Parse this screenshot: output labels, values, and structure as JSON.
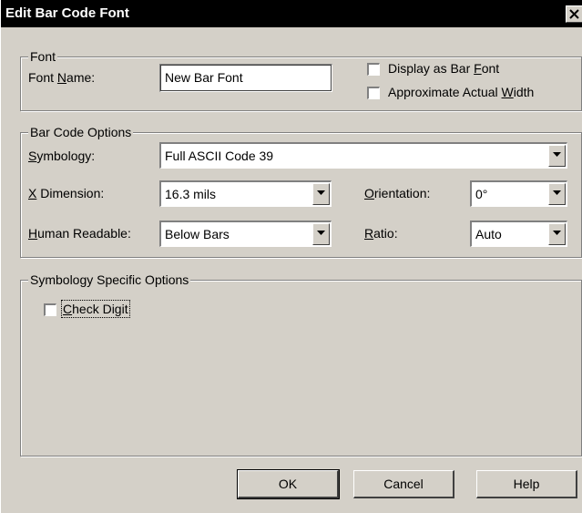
{
  "window": {
    "title": "Edit Bar Code Font"
  },
  "font_group": {
    "legend": "Font",
    "font_name_label_pre": "Font ",
    "font_name_label_u": "N",
    "font_name_label_post": "ame:",
    "font_name_value": "New Bar Font",
    "display_as_bar_font_pre": "Display as Bar ",
    "display_as_bar_font_u": "F",
    "display_as_bar_font_post": "ont",
    "display_as_bar_font_checked": false,
    "approx_width_pre": "Approximate Actual ",
    "approx_width_u": "W",
    "approx_width_post": "idth",
    "approx_width_checked": false
  },
  "barcode_group": {
    "legend": "Bar Code Options",
    "symbology_u": "S",
    "symbology_post": "ymbology:",
    "symbology_value": "Full ASCII Code 39",
    "xdim_u": "X",
    "xdim_post": " Dimension:",
    "xdim_value": "16.3 mils",
    "orientation_u": "O",
    "orientation_post": "rientation:",
    "orientation_value": "0°",
    "human_u": "H",
    "human_post": "uman Readable:",
    "human_value": "Below Bars",
    "ratio_u": "R",
    "ratio_post": "atio:",
    "ratio_value": "Auto"
  },
  "symbology_group": {
    "legend": "Symbology Specific Options",
    "check_digit_u": "C",
    "check_digit_post": "heck Digit",
    "check_digit_checked": false
  },
  "buttons": {
    "ok": "OK",
    "cancel": "Cancel",
    "help": "Help"
  },
  "icons": {
    "close": "close-icon",
    "dropdown": "chevron-down-icon"
  }
}
